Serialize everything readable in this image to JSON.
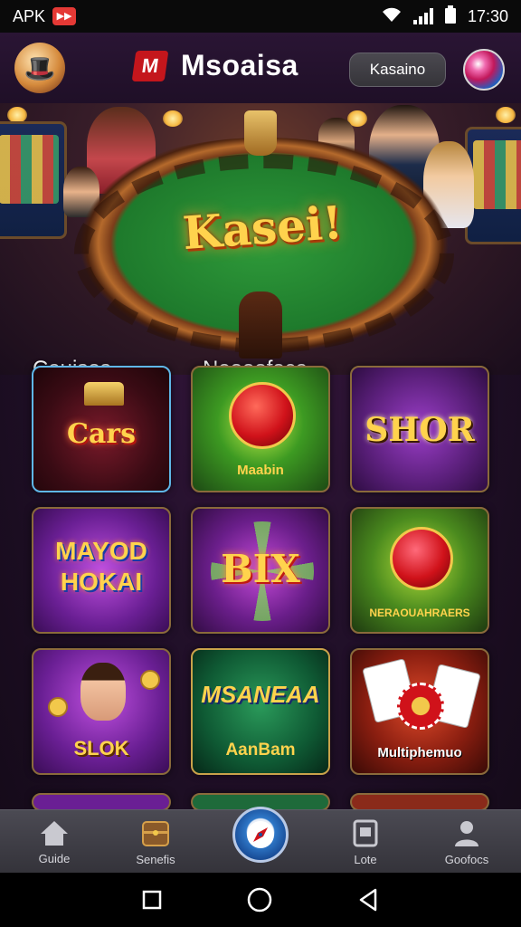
{
  "status_bar": {
    "left_text": "APK",
    "time": "17:30"
  },
  "header": {
    "brand_name": "Msoaisa",
    "button_label": "Kasaino"
  },
  "hero": {
    "title": "Kasei!",
    "label_left": "Cauisos",
    "label_right": "Neooofoca"
  },
  "games": [
    {
      "text": "Cars",
      "caption": ""
    },
    {
      "text": "",
      "caption": "Maabin"
    },
    {
      "text": "SHOR",
      "caption": ""
    },
    {
      "text": "MAYOD HOKAI",
      "caption": ""
    },
    {
      "text": "BIX",
      "caption": ""
    },
    {
      "text": "",
      "caption": "NERAOUAHRAERS"
    },
    {
      "text": "",
      "caption": "SLOK"
    },
    {
      "text": "MSANEAA",
      "caption": "AanBam"
    },
    {
      "text": "",
      "caption": "Multiphemuo"
    }
  ],
  "bottom_nav": [
    {
      "label": "Guide",
      "icon": "home-icon"
    },
    {
      "label": "Senefis",
      "icon": "chest-icon"
    },
    {
      "label": "",
      "icon": "compass-icon"
    },
    {
      "label": "Lote",
      "icon": "document-icon"
    },
    {
      "label": "Goofocs",
      "icon": "person-icon"
    }
  ],
  "colors": {
    "accent_gold": "#ffd34d",
    "bg_purple": "#22102a",
    "nav_gray": "#3f3e46"
  }
}
